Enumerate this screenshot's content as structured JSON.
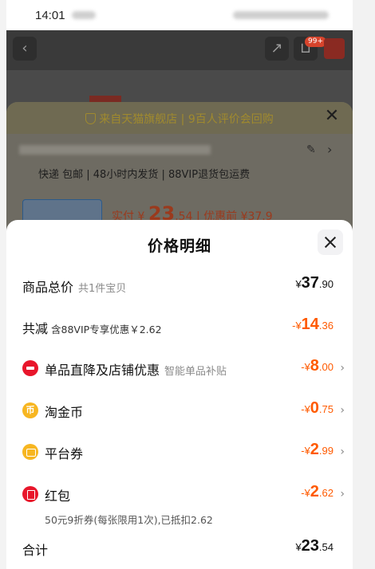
{
  "status_bar": {
    "time": "14:01"
  },
  "nav": {
    "cart_badge": "99+"
  },
  "sku_panel": {
    "shop_line": "来自天猫旗舰店 | 9百人评价会回购",
    "delivery": "快递 包邮 | 48小时内发货 | 88VIP退货包运费",
    "paid_label": "实付",
    "paid_currency": "¥",
    "paid_int": "23",
    "paid_dec": ".54",
    "before_label": "| 优惠前 ¥37.9"
  },
  "sheet": {
    "title": "价格明细",
    "rows": [
      {
        "label": "商品总价",
        "sub": "共1件宝贝",
        "currency": "¥",
        "int": "37",
        "dec": ".90",
        "color": "#111111"
      },
      {
        "label": "共减",
        "sub": "含88VIP专享优惠￥2.62",
        "currency": "-¥",
        "int": "14",
        "dec": ".36",
        "color": "#ff5a00"
      },
      {
        "label": "单品直降及店铺优惠",
        "sub": "智能单品补贴",
        "currency": "-¥",
        "int": "8",
        "dec": ".00",
        "icon": "shop-discount-icon",
        "color": "#ff5a00"
      },
      {
        "label": "淘金币",
        "sub": "",
        "currency": "-¥",
        "int": "0",
        "dec": ".75",
        "icon": "coin-icon",
        "icon_text": "币",
        "color": "#ff5a00"
      },
      {
        "label": "平台券",
        "sub": "",
        "currency": "-¥",
        "int": "2",
        "dec": ".99",
        "icon": "coupon-icon",
        "color": "#ff5a00"
      },
      {
        "label": "红包",
        "sub": "",
        "currency": "-¥",
        "int": "2",
        "dec": ".62",
        "icon": "red-packet-icon",
        "color": "#ff5a00"
      }
    ],
    "red_packet_note": "50元9折券(每张限用1次),已抵扣2.62",
    "total": {
      "label": "合计",
      "currency": "¥",
      "int": "23",
      "dec": ".54"
    }
  },
  "colors": {
    "accent": "#ff5a00",
    "danger": "#e8162b",
    "gold": "#f7b621"
  }
}
